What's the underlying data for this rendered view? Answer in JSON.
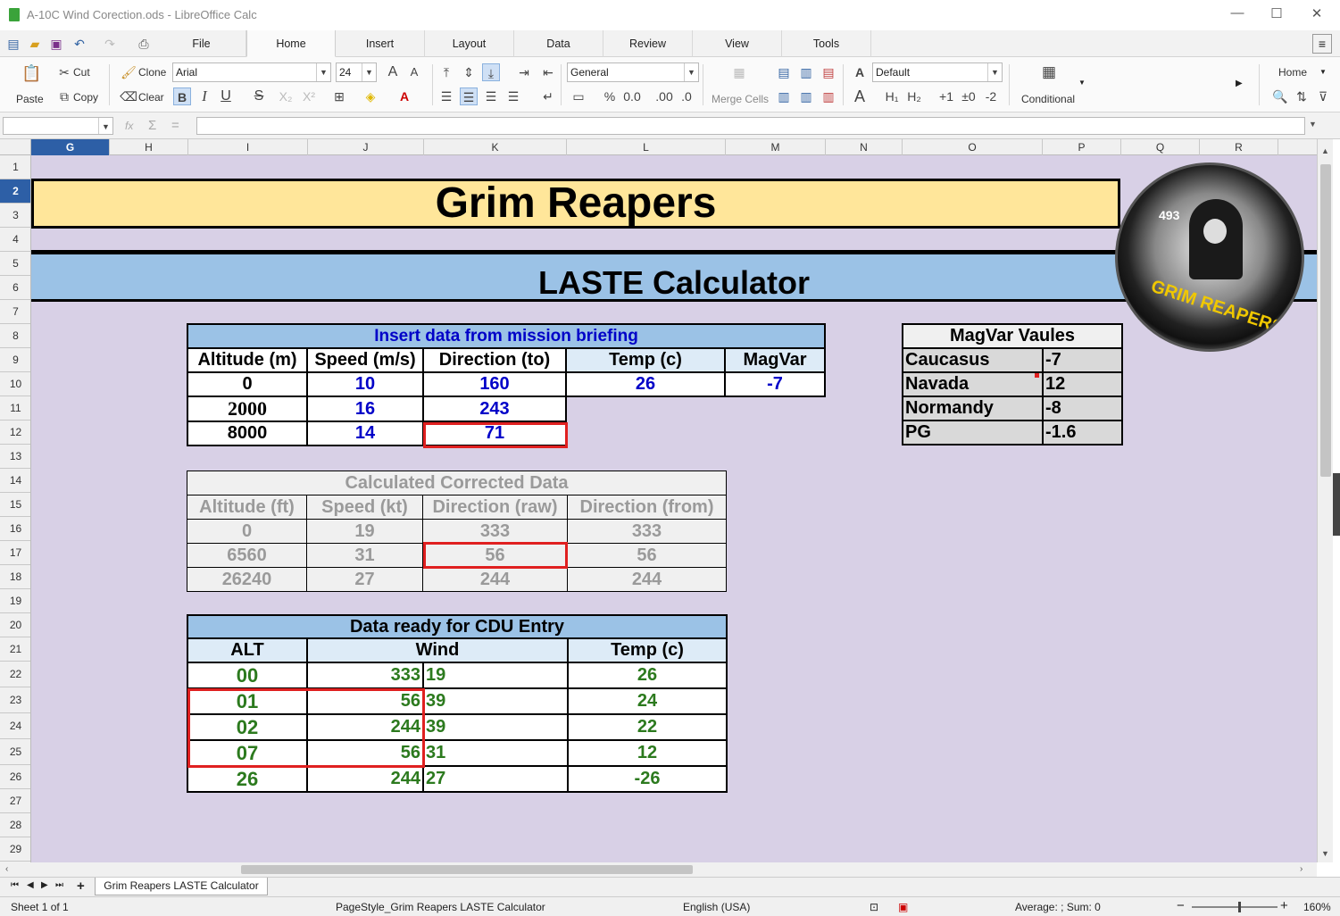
{
  "window": {
    "title": "A-10C Wind Corection.ods - LibreOffice Calc"
  },
  "menu_tabs": [
    "File",
    "Home",
    "Insert",
    "Layout",
    "Data",
    "Review",
    "View",
    "Tools"
  ],
  "active_tab": "Home",
  "ribbon": {
    "paste": "Paste",
    "cut": "Cut",
    "copy": "Copy",
    "clone": "Clone",
    "clear": "Clear",
    "font_name": "Arial",
    "font_size": "24",
    "number_format": "General",
    "merge_cells": "Merge Cells",
    "style": "Default",
    "conditional": "Conditional",
    "home_dropdown": "Home"
  },
  "formula_bar": {
    "name_box": "",
    "fx": "fx",
    "sum": "Σ",
    "equals": "=",
    "content": ""
  },
  "columns": [
    "G",
    "H",
    "I",
    "J",
    "K",
    "L",
    "M",
    "N",
    "O",
    "P",
    "Q",
    "R"
  ],
  "selected_column": "G",
  "rows": [
    "1",
    "2",
    "3",
    "4",
    "5",
    "6",
    "7",
    "8",
    "9",
    "10",
    "11",
    "12",
    "13",
    "14",
    "15",
    "16",
    "17",
    "18",
    "19",
    "20",
    "21",
    "22",
    "23",
    "24",
    "25",
    "26",
    "27",
    "28",
    "29"
  ],
  "selected_row": "2",
  "sheet": {
    "title": "Grim Reapers",
    "subtitle": "LASTE Calculator",
    "input": {
      "header": "Insert data from mission briefing",
      "cols": [
        "Altitude (m)",
        "Speed (m/s)",
        "Direction (to)"
      ],
      "rows": [
        [
          "0",
          "10",
          "160"
        ],
        [
          "2000",
          "16",
          "243"
        ],
        [
          "8000",
          "14",
          "71"
        ]
      ],
      "temp_label": "Temp (c)",
      "magvar_label": "MagVar",
      "temp": "26",
      "magvar": "-7"
    },
    "magvar_table": {
      "header": "MagVar Vaules",
      "rows": [
        [
          "Caucasus",
          "-7"
        ],
        [
          "Navada",
          "12"
        ],
        [
          "Normandy",
          "-8"
        ],
        [
          "PG",
          "-1.6"
        ]
      ]
    },
    "calculated": {
      "header": "Calculated Corrected Data",
      "cols": [
        "Altitude (ft)",
        "Speed (kt)",
        "Direction (raw)",
        "Direction (from)"
      ],
      "rows": [
        [
          "0",
          "19",
          "333",
          "333"
        ],
        [
          "6560",
          "31",
          "56",
          "56"
        ],
        [
          "26240",
          "27",
          "244",
          "244"
        ]
      ]
    },
    "cdu": {
      "header": "Data ready for CDU Entry",
      "cols": [
        "ALT",
        "Wind",
        "Temp (c)"
      ],
      "rows": [
        [
          "00",
          "333",
          "19",
          "26"
        ],
        [
          "01",
          "56",
          "39",
          "24"
        ],
        [
          "02",
          "244",
          "39",
          "22"
        ],
        [
          "07",
          "56",
          "31",
          "12"
        ],
        [
          "26",
          "244",
          "27",
          "-26"
        ]
      ]
    },
    "logo_text": "GRIM REAPERS",
    "logo_number": "493"
  },
  "sheet_tab": "Grim Reapers LASTE Calculator",
  "status": {
    "sheet": "Sheet 1 of 1",
    "page_style": "PageStyle_Grim Reapers LASTE Calculator",
    "language": "English (USA)",
    "summary": "Average: ; Sum: 0",
    "zoom": "160%"
  }
}
